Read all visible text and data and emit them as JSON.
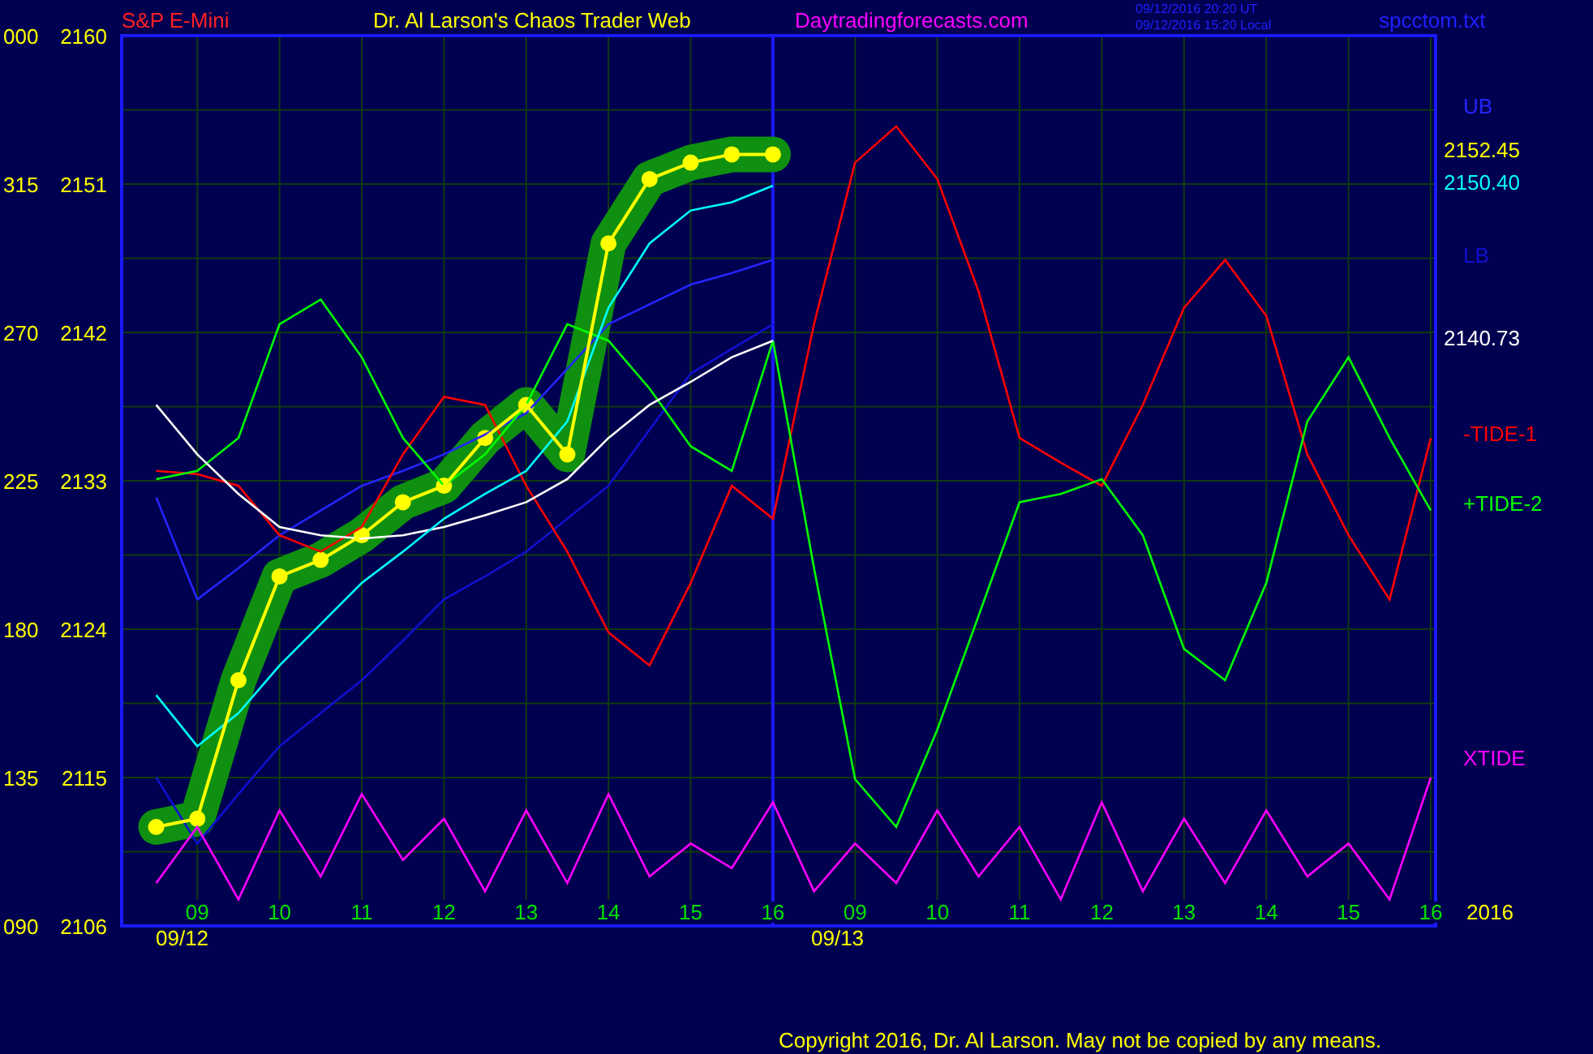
{
  "header": {
    "instrument": "S&P E-Mini",
    "title": "Dr. Al Larson's Chaos Trader Web",
    "site": "Daytradingforecasts.com",
    "timestamps": [
      "09/12/2016 20:20  UT",
      "09/12/2016 15:20  Local"
    ],
    "file": "spcctom.txt"
  },
  "degree_axis": [
    "000",
    "315",
    "270",
    "225",
    "180",
    "135",
    "090"
  ],
  "chart_data": {
    "type": "line",
    "categories": [
      null,
      "09",
      null,
      "10",
      null,
      "11",
      null,
      "12",
      null,
      "13",
      null,
      "14",
      null,
      "15",
      null,
      "16",
      null,
      "09",
      null,
      "10",
      null,
      "11",
      null,
      "12",
      null,
      "13",
      null,
      "14",
      null,
      "15",
      null,
      "16"
    ],
    "ylim": [
      2106,
      2160
    ],
    "yticks": [
      2106,
      2115,
      2124,
      2133,
      2142,
      2151,
      2160
    ],
    "series": [
      {
        "name": "UB",
        "color": "#2424ff",
        "values": [
          2132,
          2125.8,
          2127.7,
          2129.7,
          2131.2,
          2132.7,
          2133.6,
          2134.6,
          2135.8,
          2137.1,
          2139.8,
          2142.5,
          2143.7,
          2144.9,
          2145.6,
          2146.4,
          null,
          null,
          null,
          null,
          null,
          null,
          null,
          null,
          null,
          null,
          null,
          null,
          null,
          null,
          null,
          null
        ]
      },
      {
        "name": "LB",
        "color": "#1010d0",
        "values": [
          2115,
          2111.0,
          2114,
          2116.9,
          2118.9,
          2120.9,
          2123.3,
          2125.8,
          2127.2,
          2128.7,
          2130.7,
          2132.7,
          2136.1,
          2139.5,
          2141.0,
          2142.5,
          null,
          null,
          null,
          null,
          null,
          null,
          null,
          null,
          null,
          null,
          null,
          null,
          null,
          null,
          null,
          null
        ]
      },
      {
        "name": "-TIDE-1",
        "color": "#ff0000",
        "values": [
          2133.6,
          2133.4,
          2132.7,
          2129.7,
          2128.7,
          2130.2,
          2134.6,
          2138.1,
          2137.6,
          2132.7,
          2128.7,
          2123.8,
          2121.8,
          2126.8,
          2132.7,
          2130.7,
          2142.5,
          2152.3,
          2154.5,
          2151.3,
          2144.5,
          2135.6,
          2134.1,
          2132.7,
          2137.6,
          2143.5,
          2146.4,
          2143.0,
          2134.6,
          2129.7,
          2125.8,
          2135.6
        ]
      },
      {
        "name": "+TIDE-2",
        "color": "#00ff00",
        "values": [
          2133.1,
          2133.6,
          2135.6,
          2142.5,
          2144.0,
          2140.5,
          2135.6,
          2132.7,
          2134.6,
          2137.6,
          2142.5,
          2141.5,
          2138.6,
          2135.1,
          2133.6,
          2141.5,
          2127.7,
          2114.9,
          2112.0,
          2117.9,
          2124.8,
          2131.7,
          2132.2,
          2133.1,
          2129.7,
          2122.8,
          2120.9,
          2126.8,
          2136.6,
          2140.5,
          2135.6,
          2131.2
        ]
      },
      {
        "name": "XTIDE",
        "color": "#ff00ff",
        "values": [
          2108.6,
          2112.0,
          2107.6,
          2113.0,
          2109.0,
          2114.0,
          2110.0,
          2112.5,
          2108.1,
          2113.0,
          2108.6,
          2114.0,
          2109.0,
          2111.0,
          2109.5,
          2113.5,
          2108.1,
          2111.0,
          2108.6,
          2113.0,
          2109.0,
          2112.0,
          2107.6,
          2113.5,
          2108.1,
          2112.5,
          2108.6,
          2113.0,
          2109.0,
          2111.0,
          2107.6,
          2115.0
        ]
      },
      {
        "color": "#ffffff",
        "values": [
          2137.6,
          2134.6,
          2132.2,
          2130.2,
          2129.7,
          2129.5,
          2129.7,
          2130.2,
          2130.9,
          2131.7,
          2133.1,
          2135.6,
          2137.6,
          2139.0,
          2140.5,
          2141.5,
          null,
          null,
          null,
          null,
          null,
          null,
          null,
          null,
          null,
          null,
          null,
          null,
          null,
          null,
          null,
          null
        ]
      },
      {
        "color": "#00ffff",
        "values": [
          2120,
          2116.9,
          2118.9,
          2121.8,
          2124.3,
          2126.8,
          2128.7,
          2130.7,
          2132.2,
          2133.6,
          2136.6,
          2143.5,
          2147.4,
          2149.4,
          2149.9,
          2150.9,
          null,
          null,
          null,
          null,
          null,
          null,
          null,
          null,
          null,
          null,
          null,
          null,
          null,
          null,
          null,
          null
        ]
      },
      {
        "color": "#ffff00",
        "values": [
          2112.0,
          2112.5,
          2120.9,
          2127.2,
          2128.2,
          2129.7,
          2131.7,
          2132.7,
          2135.6,
          2137.6,
          2134.6,
          2147.4,
          2151.3,
          2152.3,
          2152.8,
          2152.8,
          null,
          null,
          null,
          null,
          null,
          null,
          null,
          null,
          null,
          null,
          null,
          null,
          null,
          null,
          null,
          null
        ]
      }
    ]
  },
  "value_labels": [
    {
      "text": "2152.45",
      "color": "#ffff00"
    },
    {
      "text": "2150.40",
      "color": "#00ffff"
    },
    {
      "text": "2140.73",
      "color": "#ffffff"
    }
  ],
  "year": "2016",
  "dates": [
    "09/12",
    "09/13"
  ],
  "copyright": "Copyright 2016, Dr. Al Larson. May not be copied by any means."
}
